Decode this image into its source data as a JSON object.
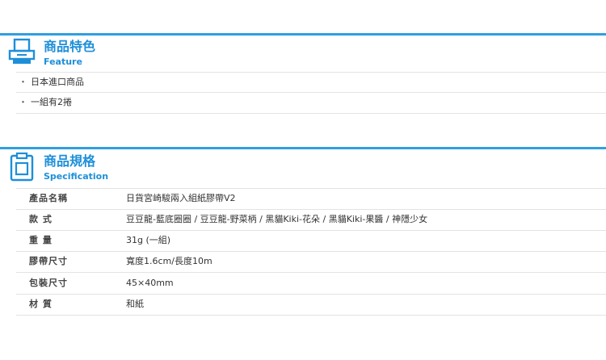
{
  "colors": {
    "accent": "#1d8fd9",
    "bar": "#2f9fe0",
    "rule": "#e3e3e3"
  },
  "feature": {
    "icon": "printer-icon",
    "title": "商品特色",
    "subtitle": "Feature",
    "items": [
      "日本進口商品",
      "一組有2捲"
    ]
  },
  "spec": {
    "icon": "clipboard-icon",
    "title": "商品規格",
    "subtitle": "Specification",
    "rows": [
      {
        "label": "產品名稱",
        "value": "日貨宮崎駿兩入組紙膠帶V2"
      },
      {
        "label": "款  式",
        "value": "豆豆龍-藍底圈圈 / 豆豆龍-野菜柄 / 黑貓Kiki-花朵 / 黑貓Kiki-果醬 / 神隱少女"
      },
      {
        "label": "重  量",
        "value": "31g (一組)"
      },
      {
        "label": "膠帶尺寸",
        "value": "寬度1.6cm/長度10m"
      },
      {
        "label": "包裝尺寸",
        "value": "45×40mm"
      },
      {
        "label": "材  質",
        "value": "和紙"
      }
    ]
  }
}
